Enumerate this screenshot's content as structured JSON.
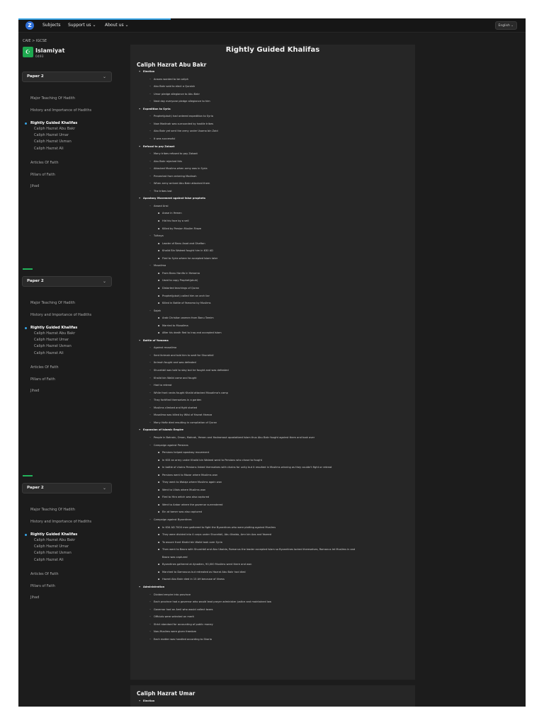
{
  "topbar": {
    "logo_text": "Z",
    "nav": [
      "Subjects",
      "Support us ⌄",
      "About us ⌄"
    ],
    "language": "English  ⌄",
    "progress_percent": 30
  },
  "sidebar": {
    "breadcrumb": "CAIE  >  IGCSE",
    "subject_icon": "☪",
    "subject_title": "Islamiyat",
    "subject_code": "0493",
    "paper_label": "Paper 2",
    "chevron": "⌄",
    "items": [
      "Major Teaching Of Hadith",
      "History and Importance of Hadiths",
      "Rightly Guided Khalifas",
      "Articles Of Faith",
      "Pillars of Faith",
      "Jihad"
    ],
    "active_index": 2,
    "subitems": [
      "Caliph Hazrat Abu Bakr",
      "Caliph Hazrat Umar",
      "Caliph Hazrat Usman",
      "Caliph Hazrat Ali"
    ]
  },
  "main": {
    "title": "Rightly Guided Khalifas",
    "sections": [
      {
        "title": "Caliph Hazrat Abu Bakr",
        "lines": [
          [
            1,
            "Election"
          ],
          [
            2,
            "Ansars wanted to be caliph"
          ],
          [
            2,
            "Abu Bakr said to elect a Quraish"
          ],
          [
            2,
            "Umar pledge allegiance to Abu Bakr"
          ],
          [
            2,
            "Next day everyone pledge allegiance to him"
          ],
          [
            1,
            "Expedition to Syria"
          ],
          [
            2,
            "Prophet(pbuh) had ordered expedition to Syria"
          ],
          [
            2,
            "Now Madinah was surrounded by hostile tribes"
          ],
          [
            2,
            "Abu Bakr yet sent the army under Usama bin Zaid"
          ],
          [
            2,
            "It was successful"
          ],
          [
            1,
            "Refusal to pay Zakaat"
          ],
          [
            2,
            "Many tribes refused to pay Zakaat"
          ],
          [
            2,
            "Abu Bakr rejected this"
          ],
          [
            2,
            "Attacked Muslims when army was in Syria"
          ],
          [
            2,
            "Prevented from entering Madinah"
          ],
          [
            2,
            "When army arrived Abu Bakr attacked them"
          ],
          [
            2,
            "The tribes lost"
          ],
          [
            1,
            "Apostasy Movement against false prophets"
          ],
          [
            2,
            "Aswad Ansi"
          ],
          [
            3,
            "Arose in Yemen"
          ],
          [
            3,
            "Hid his face by a veil"
          ],
          [
            3,
            "Killed by Persian Muslim Firoze"
          ],
          [
            2,
            "Tulhaya"
          ],
          [
            3,
            "Leader of Banu Asad and Ghaftan"
          ],
          [
            3,
            "Khalid Bin Waleed fought him in 630 AD"
          ],
          [
            3,
            "Fled to Syria where he accepted Islam later"
          ],
          [
            2,
            "Musailma"
          ],
          [
            3,
            "From Banu Hanifa in Yamama"
          ],
          [
            3,
            "Used to copy Prophet(pbuh)"
          ],
          [
            3,
            "Distorted teachings of Quran"
          ],
          [
            3,
            "Prophet(pbuh) called him an arch liar"
          ],
          [
            3,
            "Killed in Battle of Yamama by Muslims"
          ],
          [
            2,
            "Sajah"
          ],
          [
            3,
            "Arab Christian women from Banu Tamim"
          ],
          [
            3,
            "Married to Musailma"
          ],
          [
            3,
            "After his death fled to Iraq and accepted Islam"
          ],
          [
            1,
            "Battle of Yamama"
          ],
          [
            2,
            "Against musailma"
          ],
          [
            2,
            "Sent Ikrimah and told him to wait for Shurahbil"
          ],
          [
            2,
            "Ikrimah fought and was defeated"
          ],
          [
            2,
            "Shurahbil was told to stay but he fought and was defeated"
          ],
          [
            2,
            "Khalid bin Walid came and fought"
          ],
          [
            2,
            "Had to retreat"
          ],
          [
            2,
            "While front ranks fought Khalid attacked Musailma's camp"
          ],
          [
            2,
            "They fortified themselves in a garden"
          ],
          [
            2,
            "Muslims climbed and fight started"
          ],
          [
            2,
            "Musailma was killed by Wilsi of Hazrat Hamza"
          ],
          [
            2,
            "Many Hafiz died resulting in compilation of Quran"
          ],
          [
            1,
            "Expansion of Islamic Empire"
          ],
          [
            2,
            "People in Bahrain, Oman, Mahrah, Yemen and Hadramaut apostatized Islam thus Abu Bakr fought against them and took over"
          ],
          [
            2,
            "Campaign against Persians"
          ],
          [
            3,
            "Persians helped apostasy movement"
          ],
          [
            3,
            "In 633 an army under Khalid bin Waleed went to Persians who chose to fought"
          ],
          [
            3,
            "In battle of chains Persians linked themselves with chains for unity but it resulted in Muslims winning as they couldn't fight or retreat"
          ],
          [
            3,
            "Persians went to Mazar where Muslims won"
          ],
          [
            3,
            "They went to Walaja where Muslims again won"
          ],
          [
            3,
            "Went to Ullais where Muslims won"
          ],
          [
            3,
            "Fled to Hira which was also captured"
          ],
          [
            3,
            "Went to Anbar where the governor surrendered"
          ],
          [
            3,
            "Ein at tamer was also captured"
          ],
          [
            2,
            "Campaign against Byzantines"
          ],
          [
            3,
            "In 634 AD 7000 men gathered to fight the Byzantines who were plotting against Muslims"
          ],
          [
            3,
            "They were divided into 4 corps under Shurahbil, Abu Ubaida, Amr bin Aas and Yazeed"
          ],
          [
            3,
            "To assure front Khalid bin Walid took over Syria"
          ],
          [
            3,
            "Then went to Basra with Shurahbil and Abu Ubaida, Romanus the leader accepted Islam so Byzantines locked themselves, Romanus let Muslims in and"
          ],
          [
            4,
            "Basra was captured"
          ],
          [
            3,
            "Byzantines gathered at Ajnadien, 90,000 Muslims went there and won"
          ],
          [
            3,
            "Marched to Damascus but retreated as Hazrat Abu Bakr had died"
          ],
          [
            3,
            "Hazrat Abu Bakr died in 13 AH because of illness"
          ],
          [
            1,
            "Administration"
          ],
          [
            2,
            "Divided empire into province"
          ],
          [
            2,
            "Each province had a governor who would lead prayer administer justice and maintained law"
          ],
          [
            2,
            "Governor had an Amil who would collect taxes"
          ],
          [
            2,
            "Officials were selected on merit"
          ],
          [
            2,
            "Strict standard for accounting of public money"
          ],
          [
            2,
            "Non-Muslims were given freedom"
          ],
          [
            2,
            "Each matter was handled according to Sharia"
          ]
        ]
      },
      {
        "title": "Caliph Hazrat Umar",
        "lines": [
          [
            1,
            "Election"
          ]
        ]
      }
    ]
  },
  "colors": {
    "accent": "#36a3e4",
    "brand_green": "#22b35a",
    "background": "#1c1c1c",
    "card": "#262626"
  },
  "icons": {
    "logo": "logo-icon",
    "subject": "crescent-icon",
    "chevron": "chevron-down-icon"
  }
}
